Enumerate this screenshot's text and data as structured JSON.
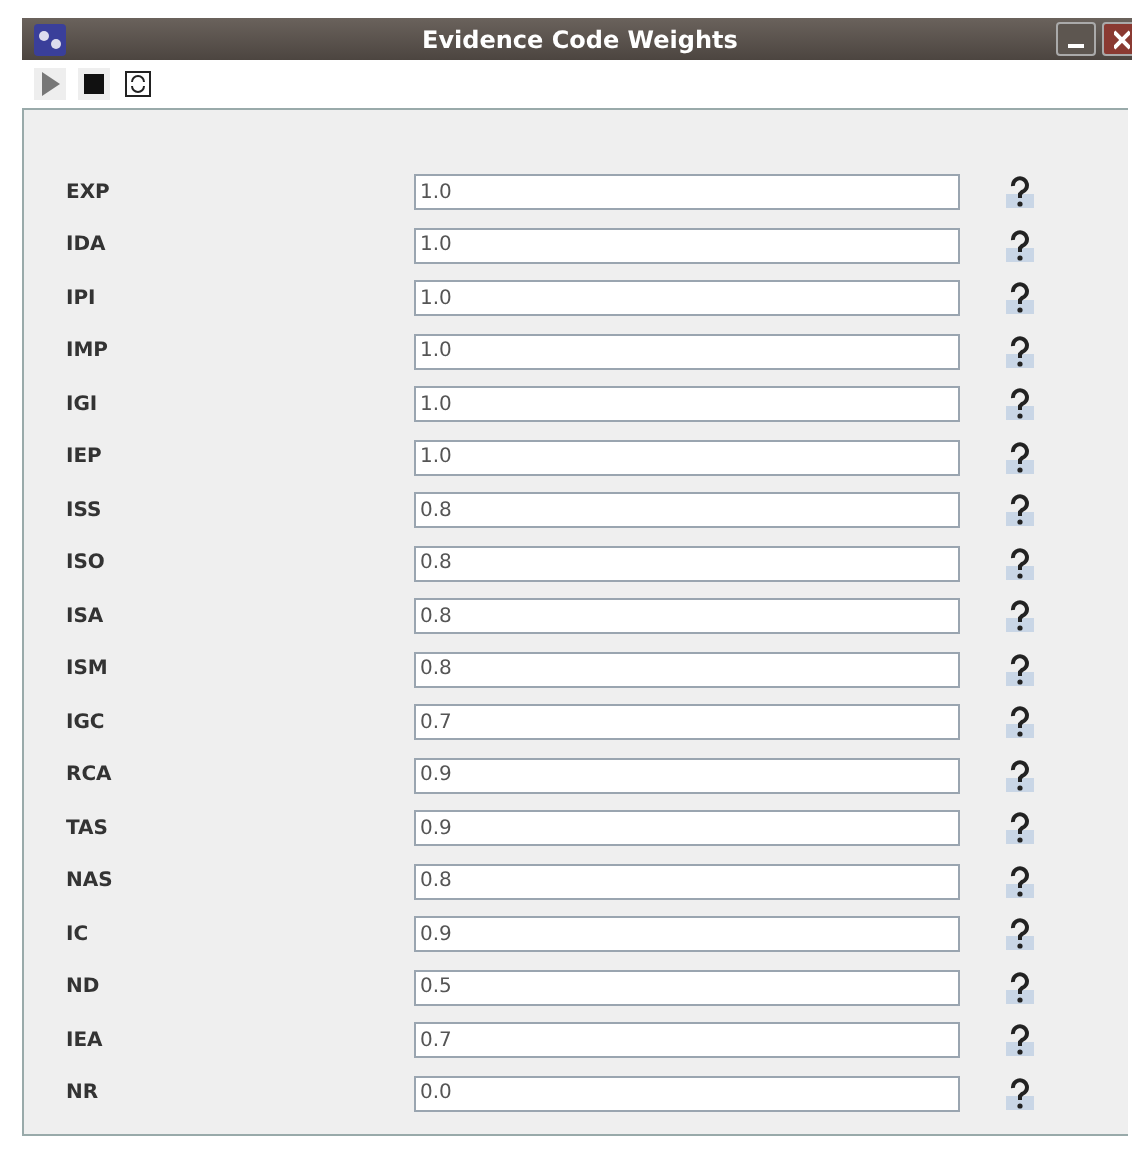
{
  "window": {
    "title": "Evidence Code Weights"
  },
  "weights": [
    {
      "code": "EXP",
      "value": "1.0"
    },
    {
      "code": "IDA",
      "value": "1.0"
    },
    {
      "code": "IPI",
      "value": "1.0"
    },
    {
      "code": "IMP",
      "value": "1.0"
    },
    {
      "code": "IGI",
      "value": "1.0"
    },
    {
      "code": "IEP",
      "value": "1.0"
    },
    {
      "code": "ISS",
      "value": "0.8"
    },
    {
      "code": "ISO",
      "value": "0.8"
    },
    {
      "code": "ISA",
      "value": "0.8"
    },
    {
      "code": "ISM",
      "value": "0.8"
    },
    {
      "code": "IGC",
      "value": "0.7"
    },
    {
      "code": "RCA",
      "value": "0.9"
    },
    {
      "code": "TAS",
      "value": "0.9"
    },
    {
      "code": "NAS",
      "value": "0.8"
    },
    {
      "code": "IC",
      "value": "0.9"
    },
    {
      "code": "ND",
      "value": "0.5"
    },
    {
      "code": "IEA",
      "value": "0.7"
    },
    {
      "code": "NR",
      "value": "0.0"
    }
  ]
}
